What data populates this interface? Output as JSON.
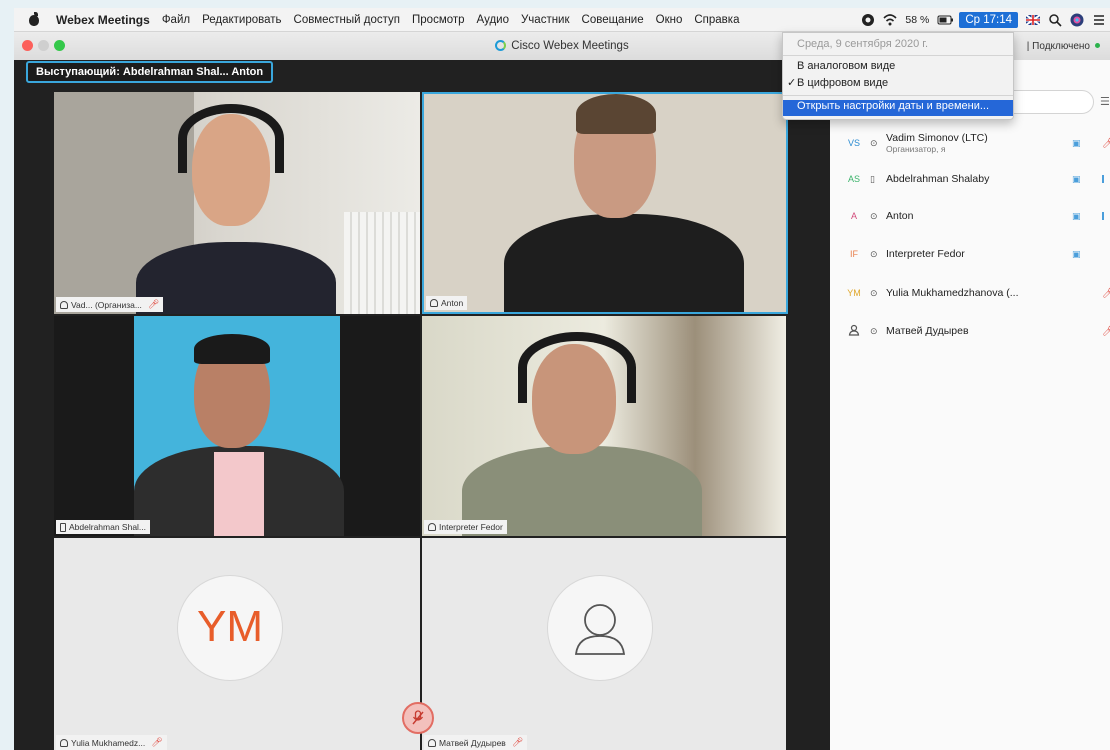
{
  "menubar": {
    "app_name": "Webex Meetings",
    "items": [
      "Файл",
      "Редактировать",
      "Совместный доступ",
      "Просмотр",
      "Аудио",
      "Участник",
      "Совещание",
      "Окно",
      "Справка"
    ],
    "battery": "58 %",
    "clock": "Ср 17:14"
  },
  "window": {
    "title": "Cisco Webex Meetings",
    "connection": "Подключено"
  },
  "stage": {
    "speaker_prefix": "Выступающий:",
    "speaker_names": "Abdelrahman Shal...  Anton",
    "tiles": [
      {
        "label": "Vad... (Организа...",
        "muted": true
      },
      {
        "label": "Anton",
        "muted": false
      },
      {
        "label": "Abdelrahman Shal...",
        "muted": false
      },
      {
        "label": "Interpreter Fedor",
        "muted": false
      },
      {
        "label": "Yulia Mukhamedz...",
        "muted": true
      },
      {
        "label": "Матвей Дудырев",
        "muted": true
      }
    ],
    "ym_initials": "YM",
    "mute_icon": "muted-mic-icon"
  },
  "clock_menu": {
    "date": "Среда, 9 сентября 2020 г.",
    "analog": "В аналоговом виде",
    "digital": "В цифровом виде",
    "settings": "Открыть настройки даты и времени..."
  },
  "participants": [
    {
      "initials": "VS",
      "name": "Vadim Simonov (LTC)",
      "sub": "Организатор, я",
      "video": true,
      "muted": true,
      "color": "#2a8bd1"
    },
    {
      "initials": "AS",
      "name": "Abdelrahman Shalaby",
      "sub": "",
      "video": true,
      "muted": false,
      "color": "#3bb36b"
    },
    {
      "initials": "A",
      "name": "Anton",
      "sub": "",
      "video": true,
      "muted": false,
      "color": "#d24a7a"
    },
    {
      "initials": "IF",
      "name": "Interpreter Fedor",
      "sub": "",
      "video": true,
      "muted": false,
      "color": "#e8804f"
    },
    {
      "initials": "YM",
      "name": "Yulia Mukhamedzhanova (...",
      "sub": "",
      "video": false,
      "muted": true,
      "color": "#e0a629"
    },
    {
      "initials": "",
      "name": "Матвей Дудырев",
      "sub": "",
      "video": false,
      "muted": true,
      "color": "#555555"
    }
  ]
}
